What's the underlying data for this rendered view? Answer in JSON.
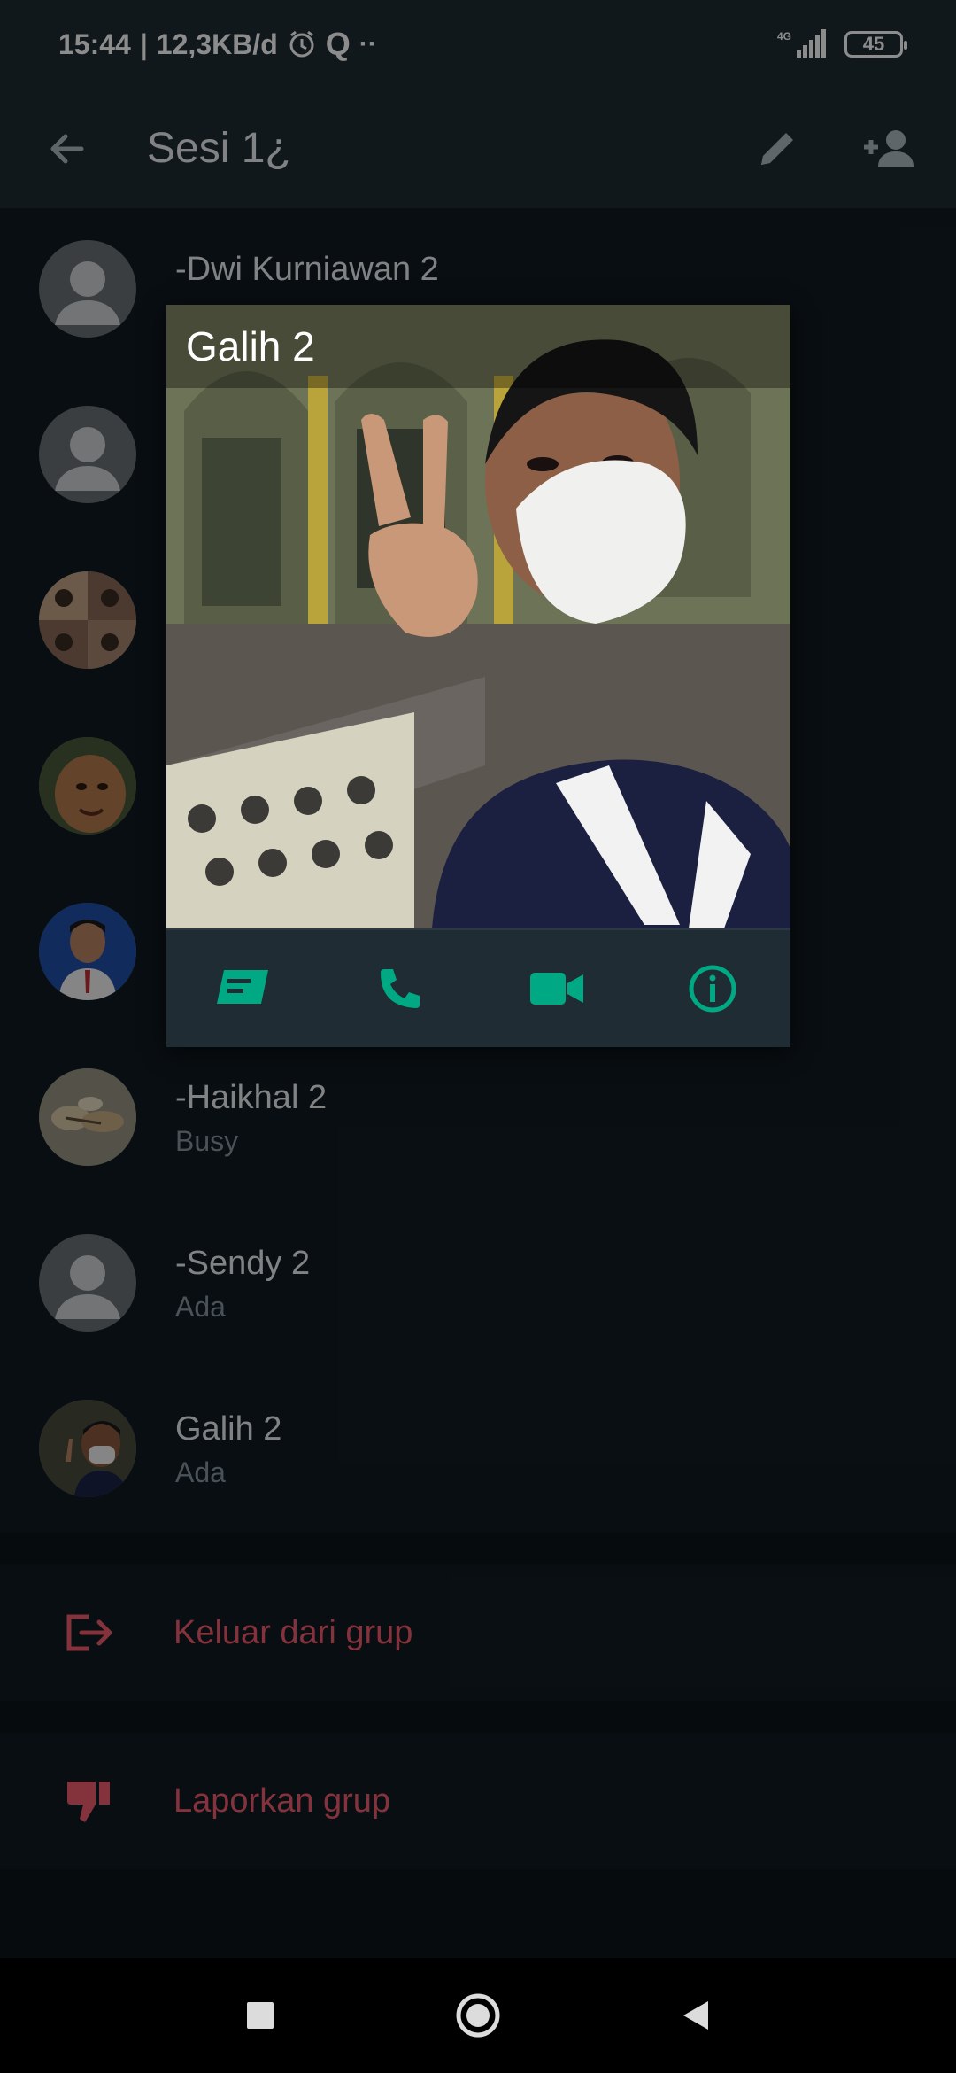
{
  "status_bar": {
    "time": "15:44",
    "net_speed": "12,3KB/d",
    "network": "4G",
    "battery": "45"
  },
  "app_bar": {
    "title": "Sesi 1¿"
  },
  "members": [
    {
      "name": "-Dwi Kurniawan 2",
      "status": "",
      "avatar": "default"
    },
    {
      "name": "",
      "status": "",
      "avatar": "default"
    },
    {
      "name": "",
      "status": "",
      "avatar": "photo-group"
    },
    {
      "name": "",
      "status": "",
      "avatar": "photo-face"
    },
    {
      "name": "",
      "status": "",
      "avatar": "photo-boy"
    },
    {
      "name": "-Haikhal 2",
      "status": "Busy",
      "avatar": "photo-shells"
    },
    {
      "name": "-Sendy 2",
      "status": "Ada",
      "avatar": "default"
    },
    {
      "name": "Galih 2",
      "status": "Ada",
      "avatar": "photo-galih"
    }
  ],
  "actions": {
    "exit_group": "Keluar dari grup",
    "report_group": "Laporkan grup"
  },
  "popup": {
    "name": "Galih 2",
    "icons": [
      "message-icon",
      "phone-icon",
      "video-call-icon",
      "info-icon"
    ]
  },
  "colors": {
    "accent": "#00a884",
    "danger": "#f15c6d",
    "background": "#111b21",
    "header": "#1f2c34"
  }
}
